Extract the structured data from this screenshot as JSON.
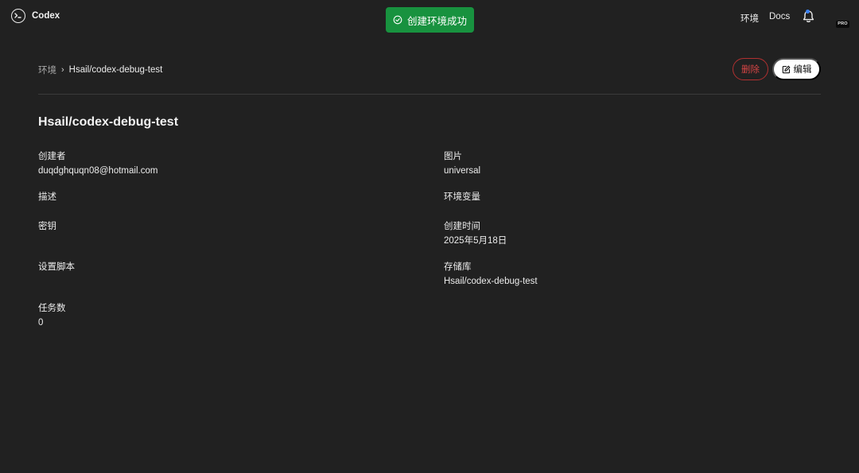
{
  "app": {
    "name": "Codex"
  },
  "toast": {
    "message": "创建环境成功"
  },
  "nav": {
    "environments": "环境",
    "docs": "Docs",
    "badge": "PRO"
  },
  "breadcrumb": {
    "parent": "环境",
    "separator": "›",
    "current": "Hsail/codex-debug-test"
  },
  "actions": {
    "delete": "删除",
    "edit": "编辑"
  },
  "page": {
    "title": "Hsail/codex-debug-test"
  },
  "fields": {
    "creator": {
      "label": "创建者",
      "value": "duqdghquqn08@hotmail.com"
    },
    "image": {
      "label": "图片",
      "value": "universal"
    },
    "description": {
      "label": "描述",
      "value": ""
    },
    "env_vars": {
      "label": "环境变量",
      "value": ""
    },
    "secrets": {
      "label": "密钥",
      "value": ""
    },
    "created_at": {
      "label": "创建时间",
      "value": "2025年5月18日"
    },
    "setup_script": {
      "label": "设置脚本",
      "value": ""
    },
    "repository": {
      "label": "存储库",
      "value": "Hsail/codex-debug-test"
    },
    "task_count": {
      "label": "任务数",
      "value": "0"
    }
  },
  "colors": {
    "background": "#212121",
    "toast": "#18923f",
    "delete": "#d64545",
    "notification_dot": "#3b82f6"
  },
  "icons": [
    "codex-logo-icon",
    "check-circle-icon",
    "bell-icon",
    "chevron-right-icon",
    "edit-icon"
  ]
}
